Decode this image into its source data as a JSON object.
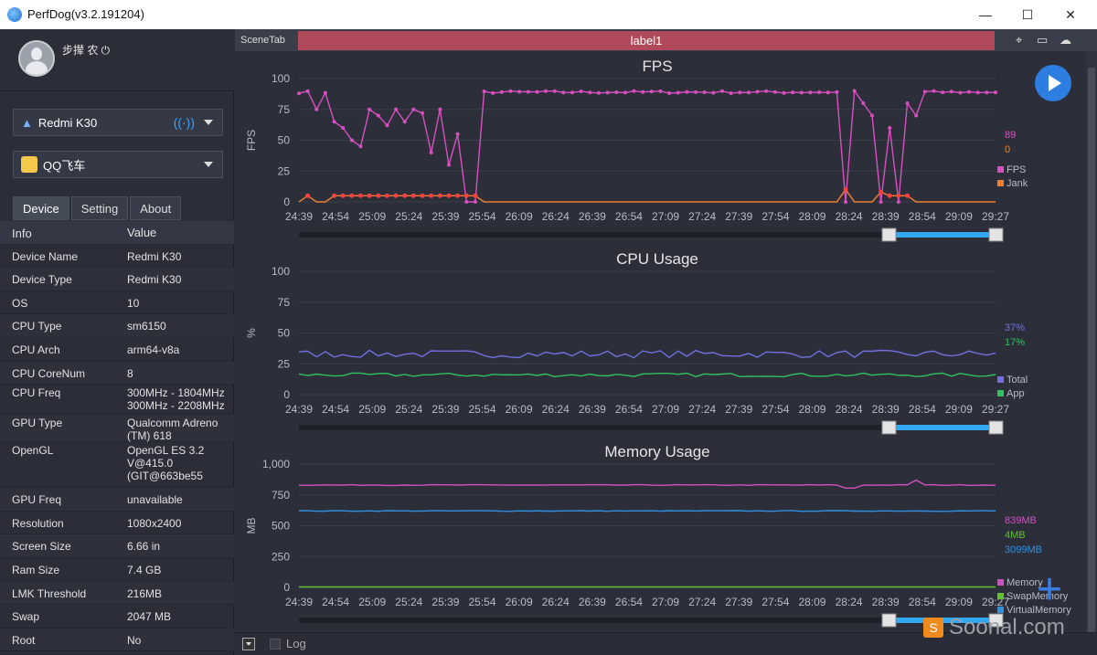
{
  "window": {
    "title": "PerfDog(v3.2.191204)",
    "minimize": "—",
    "maximize": "☐",
    "close": "✕"
  },
  "profile": {
    "name": "步撵 农 ⏻"
  },
  "device_select": {
    "value": "Redmi K30"
  },
  "app_select": {
    "value": "QQ飞车"
  },
  "tabs": [
    "Device",
    "Setting",
    "About"
  ],
  "info_header": {
    "key": "Info",
    "value": "Value"
  },
  "info_rows": [
    {
      "k": "Device Name",
      "v": "Redmi K30"
    },
    {
      "k": "Device Type",
      "v": "Redmi K30"
    },
    {
      "k": "OS",
      "v": "10"
    },
    {
      "k": "CPU Type",
      "v": "sm6150"
    },
    {
      "k": "CPU Arch",
      "v": "arm64-v8a"
    },
    {
      "k": "CPU CoreNum",
      "v": "8"
    },
    {
      "k": "CPU Freq",
      "v": "300MHz - 1804MHz\n300MHz - 2208MHz"
    },
    {
      "k": "GPU Type",
      "v": "Qualcomm Adreno\n(TM) 618"
    },
    {
      "k": "OpenGL",
      "v": "OpenGL ES 3.2\nV@415.0\n(GIT@663be55"
    },
    {
      "k": "GPU Freq",
      "v": "unavailable"
    },
    {
      "k": "Resolution",
      "v": "1080x2400"
    },
    {
      "k": "Screen Size",
      "v": "6.66 in"
    },
    {
      "k": "Ram Size",
      "v": "7.4 GB"
    },
    {
      "k": "LMK Threshold",
      "v": "216MB"
    },
    {
      "k": "Swap",
      "v": "2047 MB"
    },
    {
      "k": "Root",
      "v": "No"
    }
  ],
  "scene": {
    "tab_label": "SceneTab",
    "label": "label1"
  },
  "bottom": {
    "log_label": "Log"
  },
  "watermark": {
    "text": "Soonal.com",
    "logo": "S"
  },
  "colors": {
    "fps": "#d84fc0",
    "jank": "#f08030",
    "cpu_total": "#7070e0",
    "cpu_app": "#30c060",
    "memory": "#d050c0",
    "swap": "#60c030",
    "virtual": "#3090e0",
    "range": "#33a7f0"
  },
  "chart_data": [
    {
      "type": "line",
      "title": "FPS",
      "ylabel": "FPS",
      "ylim": [
        0,
        100
      ],
      "yticks": [
        "100",
        "75",
        "50",
        "25",
        "0"
      ],
      "xticks": [
        "24:39",
        "24:54",
        "25:09",
        "25:24",
        "25:39",
        "25:54",
        "26:09",
        "26:24",
        "26:39",
        "26:54",
        "27:09",
        "27:24",
        "27:39",
        "27:54",
        "28:09",
        "28:24",
        "28:39",
        "28:54",
        "29:09",
        "29:27"
      ],
      "current_values": [
        "89",
        "0"
      ],
      "series": [
        {
          "name": "FPS",
          "base": 89,
          "dips": [
            [
              2,
              75
            ],
            [
              3.5,
              65
            ],
            [
              4.5,
              45
            ],
            [
              5,
              60
            ],
            [
              6,
              50
            ],
            [
              6.5,
              75
            ],
            [
              7.2,
              45
            ],
            [
              8,
              75
            ],
            [
              8.5,
              58
            ],
            [
              9,
              70
            ],
            [
              9.5,
              75
            ],
            [
              10,
              62
            ],
            [
              11,
              75
            ],
            [
              11.5,
              65
            ],
            [
              12.5,
              75
            ],
            [
              13.5,
              45
            ],
            [
              14,
              72
            ],
            [
              15,
              40
            ],
            [
              16,
              75
            ],
            [
              17,
              30
            ],
            [
              18,
              55
            ],
            [
              19,
              0
            ],
            [
              20,
              0
            ],
            [
              62,
              0
            ],
            [
              63,
              90
            ],
            [
              64,
              80
            ],
            [
              65,
              70
            ],
            [
              66,
              0
            ],
            [
              67,
              60
            ],
            [
              68,
              0
            ],
            [
              69,
              80
            ],
            [
              70,
              70
            ]
          ]
        },
        {
          "name": "Jank",
          "base": 0,
          "spikes": [
            [
              1,
              5
            ],
            [
              4,
              5
            ],
            [
              5,
              5
            ],
            [
              6,
              5
            ],
            [
              7,
              5
            ],
            [
              8,
              5
            ],
            [
              9,
              5
            ],
            [
              10,
              5
            ],
            [
              11,
              5
            ],
            [
              12,
              5
            ],
            [
              13,
              5
            ],
            [
              14,
              5
            ],
            [
              15,
              5
            ],
            [
              16,
              5
            ],
            [
              17,
              5
            ],
            [
              18,
              5
            ],
            [
              19,
              5
            ],
            [
              20,
              5
            ],
            [
              62,
              10
            ],
            [
              66,
              8
            ],
            [
              67,
              5
            ],
            [
              68,
              5
            ],
            [
              69,
              5
            ]
          ]
        }
      ]
    },
    {
      "type": "line",
      "title": "CPU Usage",
      "ylabel": "%",
      "ylim": [
        0,
        100
      ],
      "yticks": [
        "100",
        "75",
        "50",
        "25",
        "0"
      ],
      "xticks": [
        "24:39",
        "24:54",
        "25:09",
        "25:24",
        "25:39",
        "25:54",
        "26:09",
        "26:24",
        "26:39",
        "26:54",
        "27:09",
        "27:24",
        "27:39",
        "27:54",
        "28:09",
        "28:24",
        "28:39",
        "28:54",
        "29:09",
        "29:27"
      ],
      "current_values": [
        "37%",
        "17%"
      ],
      "series": [
        {
          "name": "Total",
          "base": 33
        },
        {
          "name": "App",
          "base": 16
        }
      ]
    },
    {
      "type": "line",
      "title": "Memory Usage",
      "ylabel": "MB",
      "ylim": [
        0,
        1000
      ],
      "yticks": [
        "1,000",
        "750",
        "500",
        "250",
        "0"
      ],
      "xticks": [
        "24:39",
        "24:54",
        "25:09",
        "25:24",
        "25:39",
        "25:54",
        "26:09",
        "26:24",
        "26:39",
        "26:54",
        "27:09",
        "27:24",
        "27:39",
        "27:54",
        "28:09",
        "28:24",
        "28:39",
        "28:54",
        "29:09",
        "29:27"
      ],
      "current_values": [
        "839MB",
        "4MB",
        "3099MB"
      ],
      "series": [
        {
          "name": "Memory",
          "base": 830
        },
        {
          "name": "SwapMemory",
          "base": 4
        },
        {
          "name": "VirtualMemory",
          "base": 620
        }
      ]
    }
  ]
}
